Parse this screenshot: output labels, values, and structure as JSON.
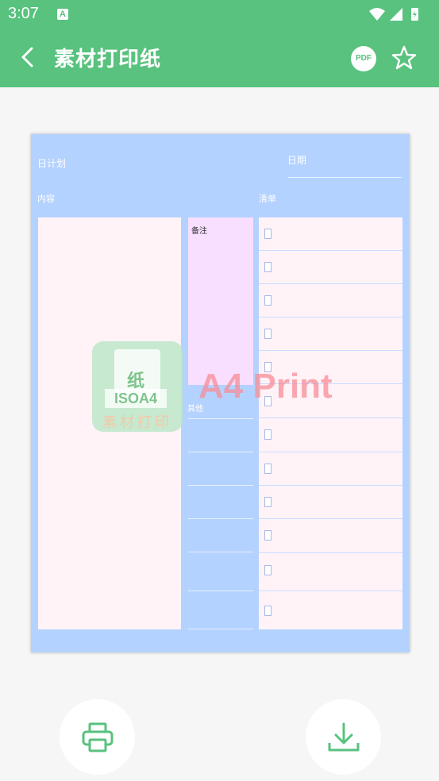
{
  "status_bar": {
    "time": "3:07",
    "notification_icon": "A"
  },
  "app_bar": {
    "title": "素材打印纸",
    "pdf_label": "PDF",
    "back_icon": "chevron-left-icon",
    "star_icon": "star-icon"
  },
  "paper": {
    "label_daily_plan": "日计划",
    "label_date": "日期",
    "label_content": "内容",
    "label_checklist": "清单",
    "label_notes": "备注",
    "label_other": "其他",
    "checklist_count": 12
  },
  "watermark": {
    "logo_char": "纸",
    "logo_text": "ISOA4",
    "logo_subtitle": "素材打印",
    "text": "A4 Print"
  },
  "actions": {
    "print_icon": "printer-icon",
    "download_icon": "download-icon"
  },
  "colors": {
    "accent": "#58c27e",
    "paper_bg": "#b4d2ff",
    "box_bg": "#fff3f8",
    "notes_bg": "#f8deff"
  }
}
